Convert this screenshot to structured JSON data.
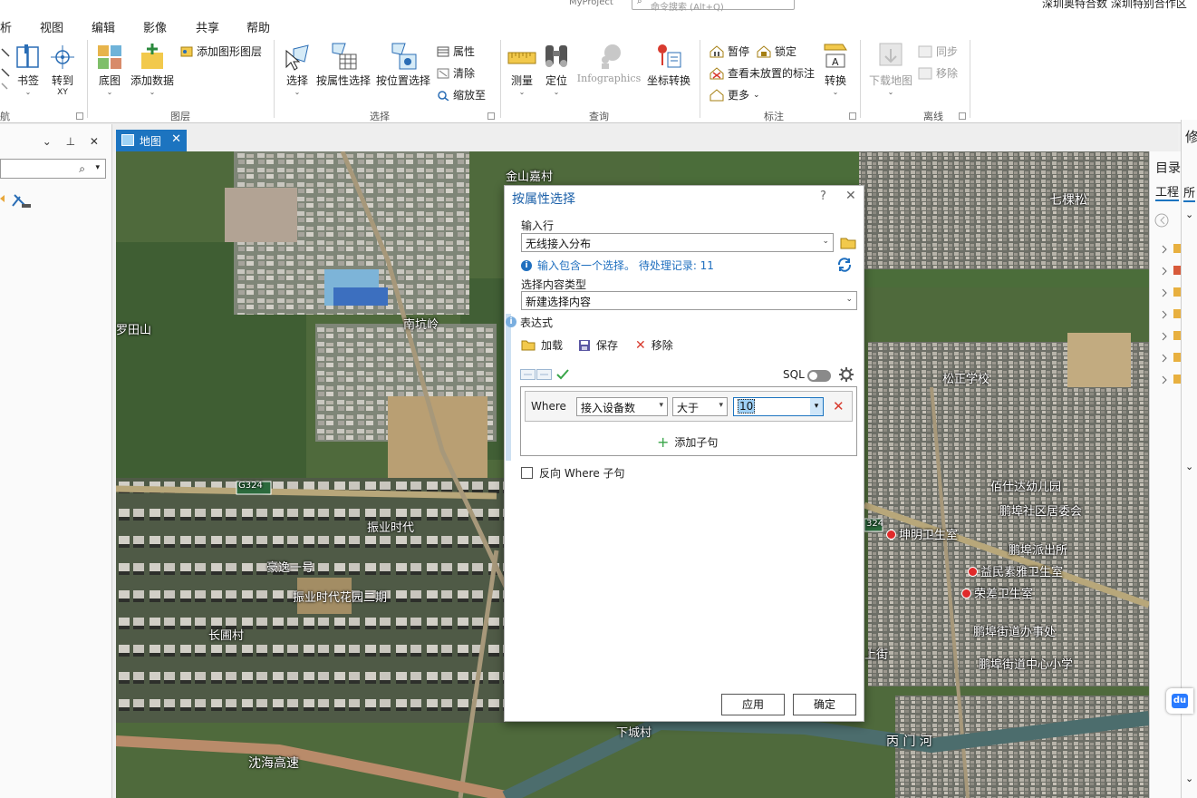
{
  "top": {
    "project": "MyProject",
    "command_search_placeholder": "命令搜索 (Alt+Q)",
    "account": "深圳奥特合数  深圳特别合作区"
  },
  "menu": [
    "析",
    "视图",
    "编辑",
    "影像",
    "共享",
    "帮助"
  ],
  "ribbon": {
    "nav": {
      "bookmark": "书签",
      "goto_xy_1": "转到",
      "goto_xy_2": "XY",
      "group": "航"
    },
    "layer": {
      "basemap": "底图",
      "add_data": "添加数据",
      "add_graphics": "添加图形图层",
      "group": "图层"
    },
    "selection": {
      "select": "选择",
      "by_attribute": "按属性选择",
      "by_location": "按位置选择",
      "attributes": "属性",
      "clear": "清除",
      "zoom_to": "缩放至",
      "group": "选择"
    },
    "inquiry": {
      "measure": "测量",
      "locate": "定位",
      "infographics": "Infographics",
      "coord_convert": "坐标转换",
      "group": "查询"
    },
    "labeling": {
      "pause": "暂停",
      "lock": "锁定",
      "view_unplaced": "查看未放置的标注",
      "more": "更多",
      "convert": "转换",
      "group": "标注"
    },
    "offline": {
      "download_map": "下载地图",
      "sync": "同步",
      "remove": "移除",
      "group": "离线"
    }
  },
  "map_tab": {
    "label": "地图"
  },
  "map_labels": {
    "jinshan": "金山嘉村",
    "qikesong": "七棵松",
    "luotianshan": "罗田山",
    "nankeng": "南坑岭",
    "songzheng": "松正学校",
    "g324": "G324",
    "g324b": "324",
    "baishida": "佰仕达幼儿园",
    "pengzhou": "鹏埠社区居委会",
    "kunming": "坤明卫生室",
    "police": "鹏埠派出所",
    "yimin": "益民素雅卫生室",
    "rongan": "荣差卫生室",
    "jiedao": "鹏埠街道办事处",
    "school": "鹏埠街道中心小学",
    "zhenye": "振业时代",
    "zhenye_garden": "振业时代花园二期",
    "changlong": "长圃村",
    "haoyi": "豪逸一号",
    "xiacheng": "下城村",
    "shenhai": "沈海高速",
    "river": "丙 门 河",
    "shangjie": "上街"
  },
  "right_pane": {
    "catalog": "目录",
    "project_tab": "工程",
    "all_tab": "所",
    "modify": "修"
  },
  "dialog": {
    "title": "按属性选择",
    "input_rows_label": "输入行",
    "input_rows_value": "无线接入分布",
    "info_text": "输入包含一个选择。 待处理记录: 11",
    "selection_type_label": "选择内容类型",
    "selection_type_value": "新建选择内容",
    "expression_label": "表达式",
    "load": "加载",
    "save": "保存",
    "remove": "移除",
    "sql": "SQL",
    "where": "Where",
    "field": "接入设备数",
    "operator": "大于",
    "value": "10",
    "add_clause": "添加子句",
    "invert_where": "反向 Where 子句",
    "apply": "应用",
    "ok": "确定"
  }
}
